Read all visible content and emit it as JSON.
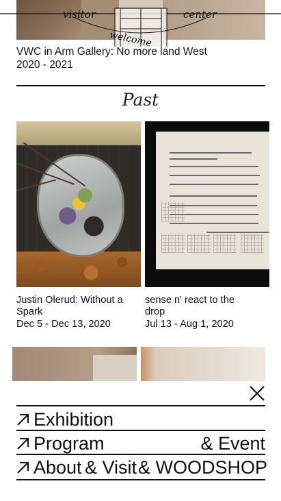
{
  "logo": {
    "text_left": "visitor",
    "text_right": "center",
    "text_curve": "welcome"
  },
  "top_item": {
    "title": "VWC in Arm Gallery: No more land West",
    "dates": "2020 - 2021"
  },
  "section": {
    "heading": "Past"
  },
  "cards": [
    {
      "title": "Justin Olerud: Without a Spark",
      "title_line1": "Justin Olerud: Without a",
      "title_line2": "Spark",
      "dates": "Dec 5 - Dec 13, 2020"
    },
    {
      "title": "sense n' react to the drop",
      "title_line1": "sense n' react to the",
      "title_line2": "drop",
      "dates": "Jul 13 - Aug 1, 2020"
    }
  ],
  "menu": {
    "close_icon": "close-icon",
    "arrow_icon": "arrow-up-right-icon",
    "items": [
      {
        "label": "Exhibition"
      },
      {
        "label": "Program",
        "extra": "& Event"
      },
      {
        "label": "About",
        "extra1": "& Visit",
        "extra2": "& WOODSHOP"
      }
    ]
  },
  "colors": {
    "text": "#111111",
    "background": "#ffffff"
  }
}
